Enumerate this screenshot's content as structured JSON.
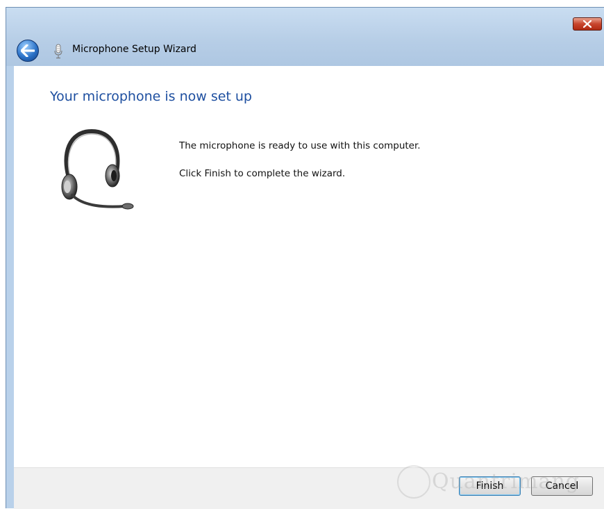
{
  "window": {
    "title": "Microphone Setup Wizard",
    "icons": {
      "back": "back-arrow-icon",
      "app": "microphone-icon",
      "close": "close-icon"
    }
  },
  "main": {
    "heading": "Your microphone is now set up",
    "illustration": "headset-icon",
    "message_ready": "The microphone is ready to use with this computer.",
    "message_finish": "Click Finish to complete the wizard."
  },
  "footer": {
    "finish_label": "Finish",
    "cancel_label": "Cancel"
  },
  "watermark": {
    "text": "Quantrimang"
  },
  "colors": {
    "heading": "#1e4fa0",
    "titlebar": "#b9d1ea",
    "close_button": "#c8452d"
  }
}
